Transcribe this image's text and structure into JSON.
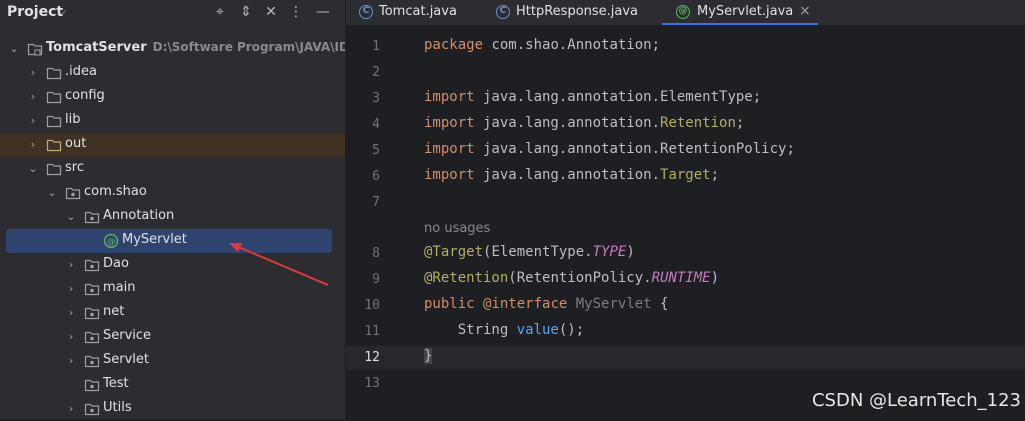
{
  "project_panel": {
    "title": "Project",
    "tree": [
      {
        "label": "TomcatServer",
        "path": "D:\\Software Program\\JAVA\\IDEA\\",
        "kind": "module"
      },
      {
        "label": ".idea",
        "kind": "folder"
      },
      {
        "label": "config",
        "kind": "folder"
      },
      {
        "label": "lib",
        "kind": "folder"
      },
      {
        "label": "out",
        "kind": "folder-excluded"
      },
      {
        "label": "src",
        "kind": "folder-src"
      },
      {
        "label": "com.shao",
        "kind": "package"
      },
      {
        "label": "Annotation",
        "kind": "package"
      },
      {
        "label": "MyServlet",
        "kind": "annotation-file",
        "selected": true
      },
      {
        "label": "Dao",
        "kind": "package"
      },
      {
        "label": "main",
        "kind": "package"
      },
      {
        "label": "net",
        "kind": "package"
      },
      {
        "label": "Service",
        "kind": "package"
      },
      {
        "label": "Servlet",
        "kind": "package"
      },
      {
        "label": "Test",
        "kind": "package"
      },
      {
        "label": "Utils",
        "kind": "package"
      }
    ]
  },
  "tabs": [
    {
      "label": "Tomcat.java",
      "icon": "class-icon"
    },
    {
      "label": "HttpResponse.java",
      "icon": "class-icon"
    },
    {
      "label": "MyServlet.java",
      "icon": "annotation-icon",
      "active": true
    }
  ],
  "editor": {
    "line_numbers": [
      "1",
      "2",
      "3",
      "4",
      "5",
      "6",
      "7",
      "8",
      "9",
      "10",
      "11",
      "12",
      "13"
    ],
    "usage_hint": "no usages",
    "tokens": {
      "package_kw": "package",
      "package_name": " com.shao.Annotation;",
      "import_kw": "import",
      "import_prefix": " java.lang.annotation.",
      "imp1": "ElementType",
      "imp2": "Retention",
      "imp3": "RetentionPolicy",
      "imp4": "Target",
      "semi": ";",
      "at_target": "@Target",
      "target_args_a": "(ElementType.",
      "target_const": "TYPE",
      "close_paren": ")",
      "at_retention": "@Retention",
      "retention_args_a": "(RetentionPolicy.",
      "retention_const": "RUNTIME",
      "public_kw": "public",
      "at_interface": "@interface",
      "type_name": "MyServlet",
      "open_brace": "{",
      "string_type": "    String ",
      "value_fn": "value",
      "value_end": "();",
      "close_brace": "}"
    }
  },
  "watermark": "CSDN @LearnTech_123"
}
